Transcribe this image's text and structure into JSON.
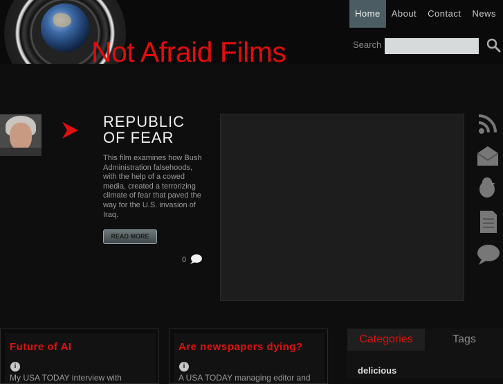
{
  "header": {
    "brand": "Not Afraid Films",
    "nav": [
      "Home",
      "About",
      "Contact",
      "News"
    ],
    "search_label": "Search",
    "search_value": ""
  },
  "feature": {
    "title": "REPUBLIC OF FEAR",
    "description": "This film examines how Bush Administration falsehoods, with the help of a cowed media, created a terrorizing climate of fear that paved the way for the U.S. invasion of Iraq.",
    "read_more": "READ MORE",
    "comment_count": "0"
  },
  "social_icons": [
    "rss-icon",
    "email-icon",
    "twitter-bird-icon",
    "document-icon",
    "chat-bubble-icon"
  ],
  "posts": [
    {
      "title": "Future of AI",
      "excerpt": "My USA TODAY interview with"
    },
    {
      "title": "Are newspapers dying?",
      "excerpt": "A USA TODAY managing editor and"
    }
  ],
  "sidebar": {
    "tabs": [
      "Categories",
      "Tags"
    ],
    "first_item": "delicious"
  },
  "colors": {
    "accent": "#e01010",
    "nav_active": "#4b5c62",
    "background": "#0e0e0e"
  }
}
